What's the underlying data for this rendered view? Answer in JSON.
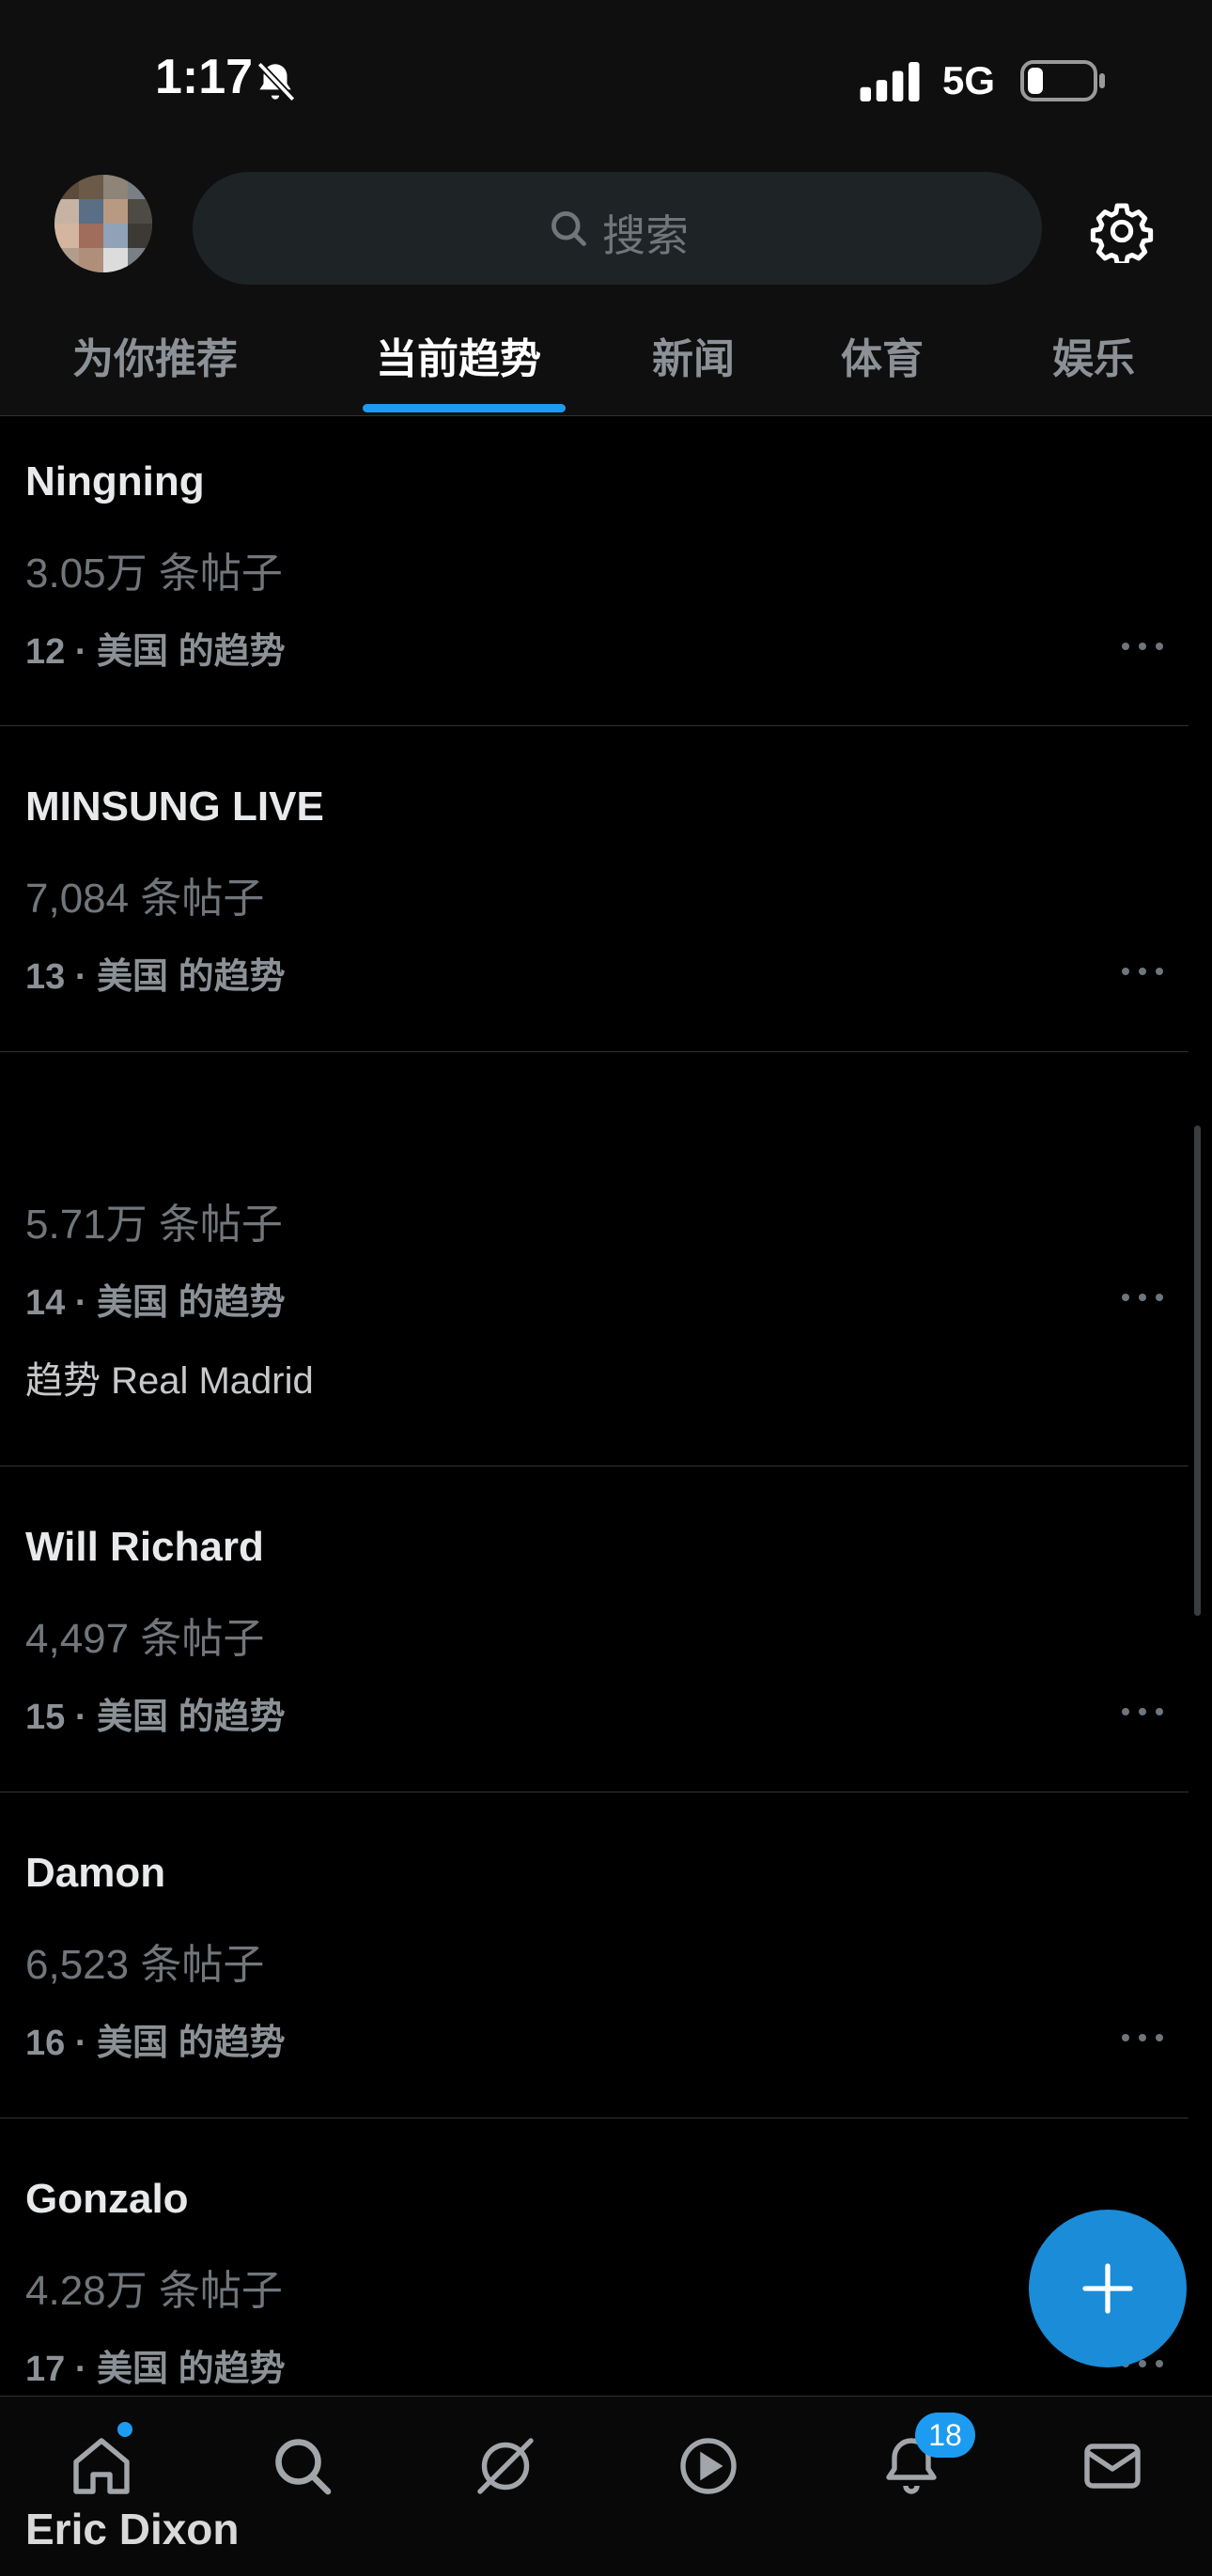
{
  "status_bar": {
    "time": "1:17",
    "network": "5G"
  },
  "search": {
    "placeholder": "搜索"
  },
  "tabs": [
    {
      "label": "为你推荐",
      "active": false
    },
    {
      "label": "当前趋势",
      "active": true
    },
    {
      "label": "新闻",
      "active": false
    },
    {
      "label": "体育",
      "active": false
    },
    {
      "label": "娱乐",
      "active": false
    }
  ],
  "trends": [
    {
      "name": "Ningning",
      "count": "3.05万 条帖子",
      "rank": "12 · 美国 的趋势"
    },
    {
      "name": "MINSUNG LIVE",
      "count": "7,084 条帖子",
      "rank": "13 · 美国 的趋势"
    },
    {
      "name": "",
      "count": "5.71万 条帖子",
      "rank": "14 · 美国 的趋势",
      "extra": "趋势 Real Madrid"
    },
    {
      "name": "Will Richard",
      "count": "4,497 条帖子",
      "rank": "15 · 美国 的趋势"
    },
    {
      "name": "Damon",
      "count": "6,523 条帖子",
      "rank": "16 · 美国 的趋势"
    },
    {
      "name": "Gonzalo",
      "count": "4.28万 条帖子",
      "rank": "17 · 美国 的趋势"
    }
  ],
  "bottom_nav": {
    "items": [
      "home-icon",
      "search-icon",
      "grok-icon",
      "video-icon",
      "notifications-icon",
      "messages-icon"
    ],
    "notification_count": "18",
    "account_name": "Eric Dixon"
  },
  "colors": {
    "accent": "#1d9bf0",
    "background": "#000000",
    "secondary_text": "#71767b"
  }
}
